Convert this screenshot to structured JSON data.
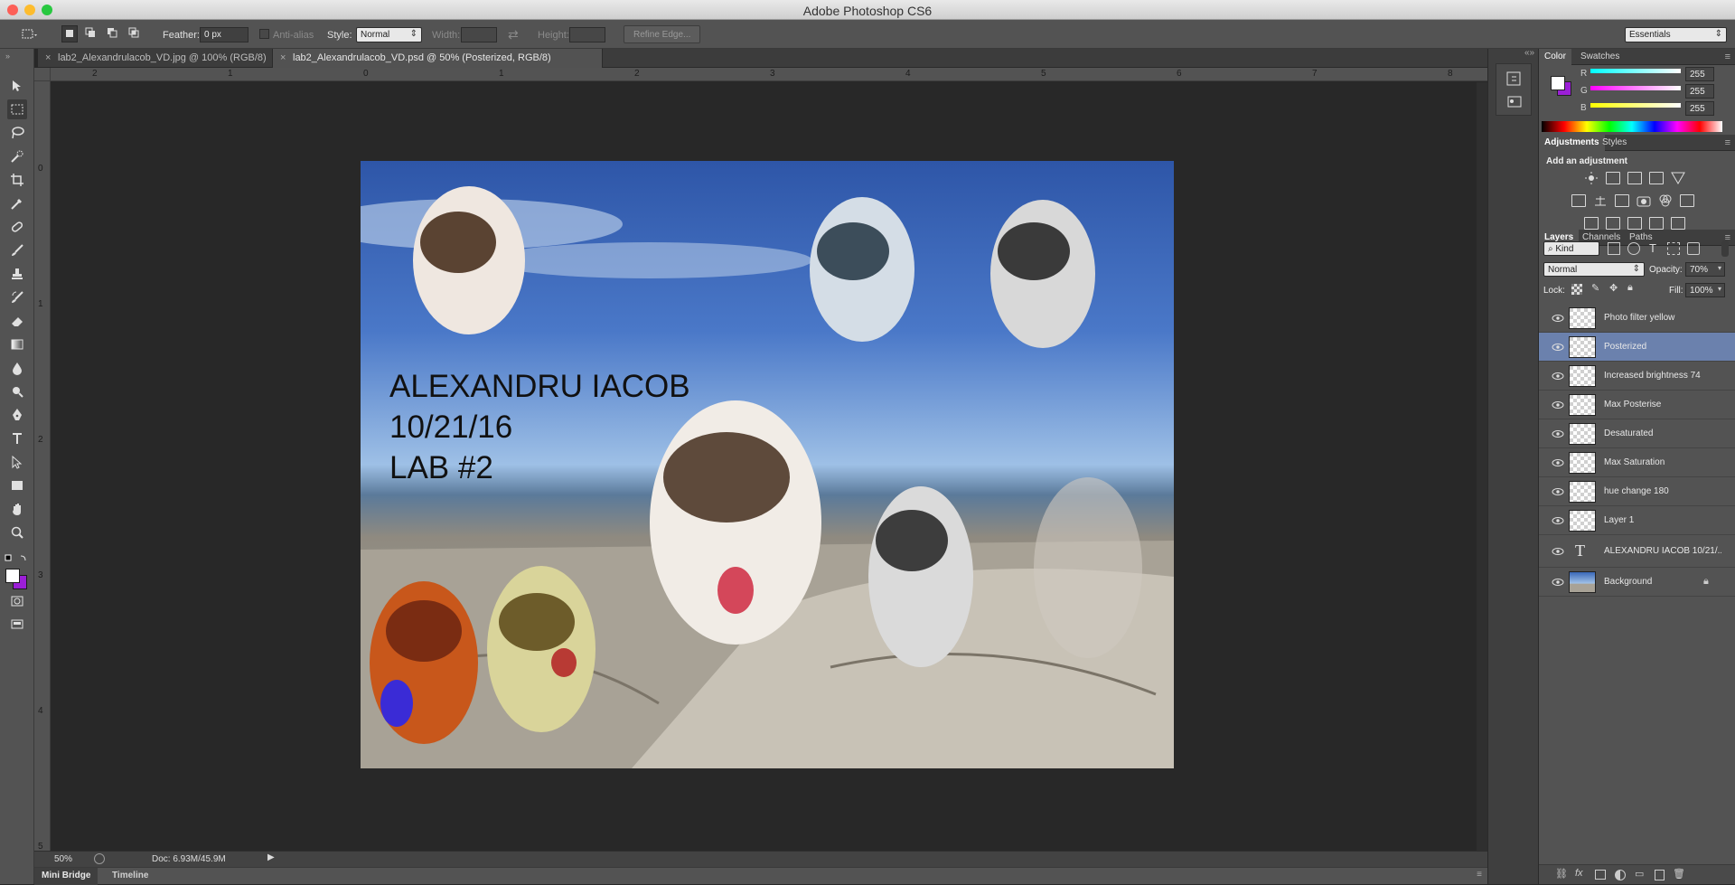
{
  "app": {
    "title": "Adobe Photoshop CS6"
  },
  "options_bar": {
    "feather_label": "Feather:",
    "feather_value": "0 px",
    "anti_alias_label": "Anti-alias",
    "style_label": "Style:",
    "style_value": "Normal",
    "width_label": "Width:",
    "height_label": "Height:",
    "refine_edge_label": "Refine Edge...",
    "workspace_value": "Essentials"
  },
  "document_tabs": [
    {
      "label": "lab2_Alexandrulacob_VD.jpg @ 100% (RGB/8)",
      "active": false
    },
    {
      "label": "lab2_Alexandrulacob_VD.psd @ 50% (Posterized, RGB/8)",
      "active": true
    }
  ],
  "rulers": {
    "top": [
      "2",
      "1",
      "0",
      "1",
      "2",
      "3",
      "4",
      "5",
      "6",
      "7",
      "8"
    ],
    "left": [
      "0",
      "1",
      "2",
      "3",
      "4",
      "5"
    ]
  },
  "canvas": {
    "text_lines": [
      "ALEXANDRU IACOB",
      "10/21/16",
      "LAB #2"
    ]
  },
  "status": {
    "zoom": "50%",
    "doc_size": "Doc: 6.93M/45.9M"
  },
  "bottom_tabs": [
    "Mini Bridge",
    "Timeline"
  ],
  "color_panel": {
    "tabs": [
      "Color",
      "Swatches"
    ],
    "r_label": "R",
    "r_value": "255",
    "g_label": "G",
    "g_value": "255",
    "b_label": "B",
    "b_value": "255",
    "foreground": "#ffffff",
    "background": "#9b1fd6"
  },
  "adjustments_panel": {
    "tabs": [
      "Adjustments",
      "Styles"
    ],
    "heading": "Add an adjustment"
  },
  "layers_panel": {
    "tabs": [
      "Layers",
      "Channels",
      "Paths"
    ],
    "kind_label": "Kind",
    "blend_mode": "Normal",
    "opacity_label": "Opacity:",
    "opacity_value": "70%",
    "lock_label": "Lock:",
    "fill_label": "Fill:",
    "fill_value": "100%",
    "layers": [
      {
        "name": "Photo filter yellow",
        "selected": false,
        "type": "pixel"
      },
      {
        "name": "Posterized",
        "selected": true,
        "type": "pixel"
      },
      {
        "name": "Increased brightness 74",
        "selected": false,
        "type": "pixel"
      },
      {
        "name": "Max Posterise",
        "selected": false,
        "type": "pixel"
      },
      {
        "name": "Desaturated",
        "selected": false,
        "type": "pixel"
      },
      {
        "name": "Max Saturation",
        "selected": false,
        "type": "pixel"
      },
      {
        "name": "hue change 180",
        "selected": false,
        "type": "pixel"
      },
      {
        "name": "Layer 1",
        "selected": false,
        "type": "pixel"
      },
      {
        "name": "ALEXANDRU IACOB 10/21/...",
        "selected": false,
        "type": "text"
      },
      {
        "name": "Background",
        "selected": false,
        "type": "background"
      }
    ]
  },
  "icons": [
    "marquee-tool-icon",
    "move-tool-icon",
    "lasso-tool-icon",
    "quick-selection-icon",
    "crop-tool-icon",
    "eyedropper-icon",
    "healing-brush-icon",
    "brush-icon",
    "clone-stamp-icon",
    "history-brush-icon",
    "eraser-icon",
    "gradient-icon",
    "blur-icon",
    "dodge-icon",
    "pen-icon",
    "type-tool-icon",
    "path-selection-icon",
    "rectangle-tool-icon",
    "hand-tool-icon",
    "zoom-tool-icon"
  ]
}
